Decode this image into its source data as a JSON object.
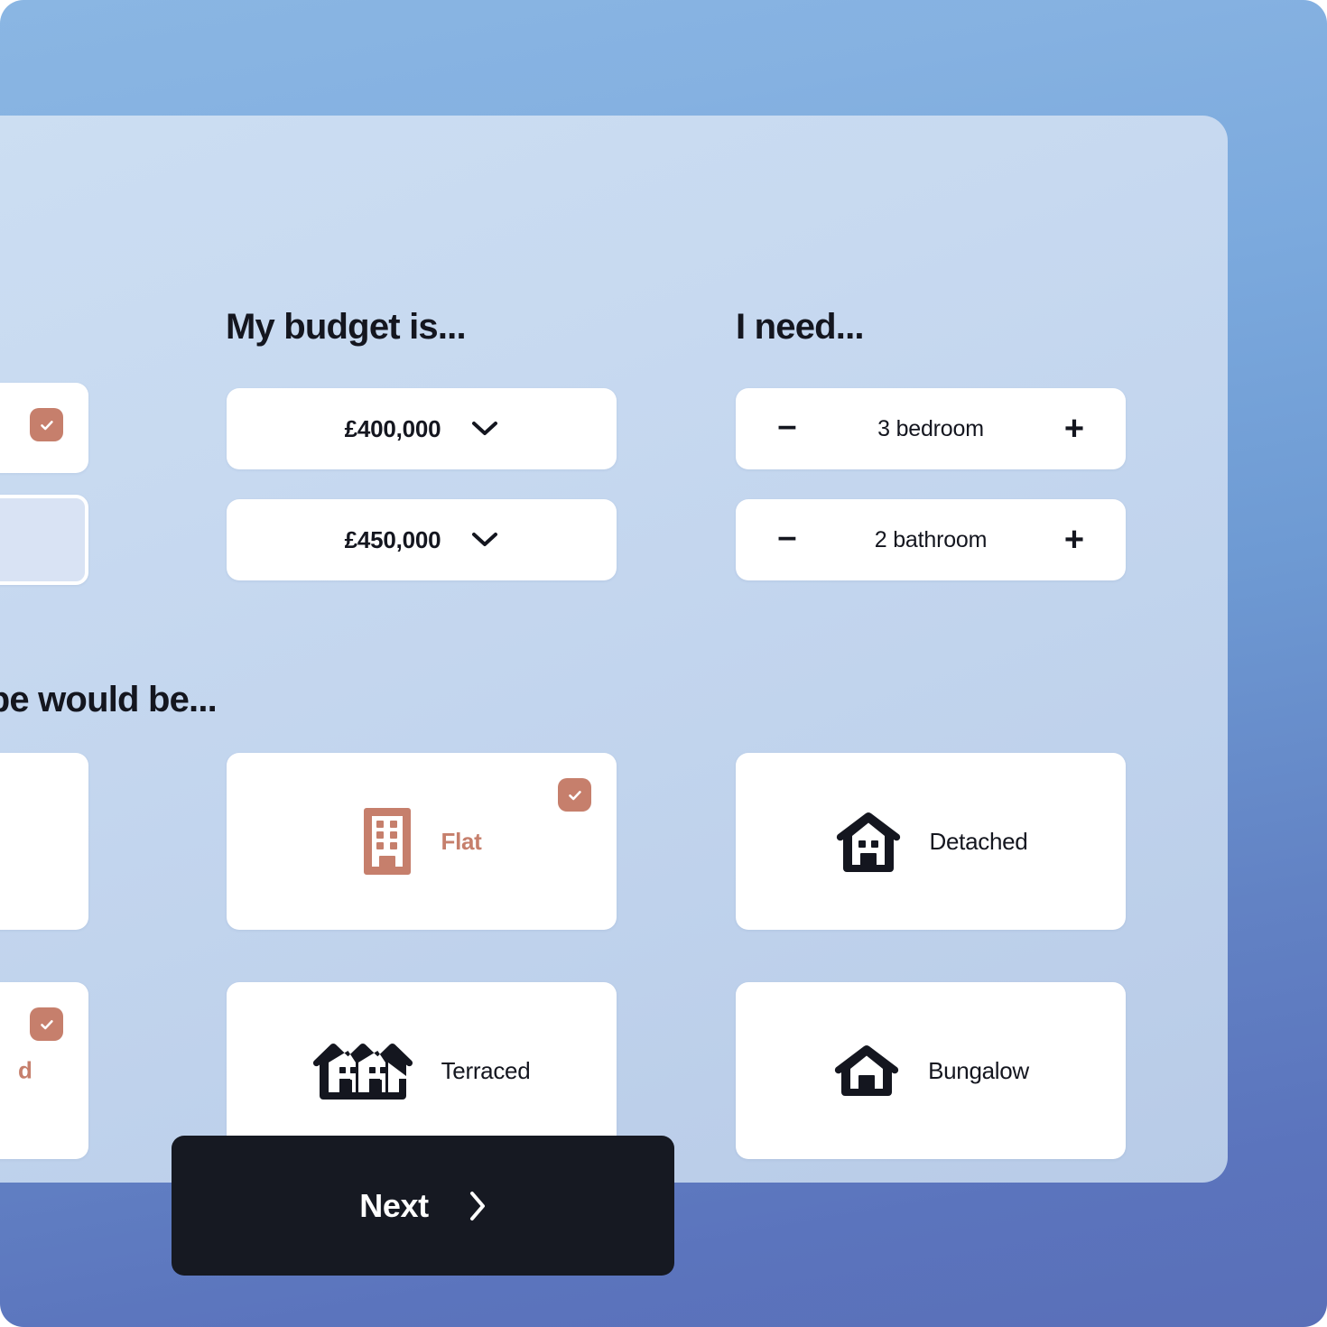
{
  "theme": {
    "accent": "#c67f6c",
    "ink": "#14161f",
    "panel_bg": "#cddff3",
    "card_bg": "#ffffff",
    "button_bg": "#161922",
    "backdrop_top": "#8ab6e3",
    "backdrop_bottom": "#5a6fb8"
  },
  "budget": {
    "heading": "My budget is...",
    "min": {
      "value": "£400,000",
      "icon": "chevron-down-icon"
    },
    "max": {
      "value": "£450,000",
      "icon": "chevron-down-icon"
    }
  },
  "needs": {
    "heading": "I need...",
    "bedroom": {
      "value": "3 bedroom",
      "decrement_label": "–",
      "increment_label": "+"
    },
    "bathroom": {
      "value": "2 bathroom",
      "decrement_label": "–",
      "increment_label": "+"
    }
  },
  "property_type": {
    "heading": "operty type would be...",
    "cards": [
      {
        "label": "Flat",
        "icon": "apartment-building-icon",
        "selected": true
      },
      {
        "label": "Detached",
        "icon": "detached-house-icon",
        "selected": false
      },
      {
        "label": "Terraced",
        "icon": "terraced-houses-icon",
        "selected": false
      },
      {
        "label": "Bungalow",
        "icon": "bungalow-house-icon",
        "selected": false
      }
    ],
    "clipped_card_label": "d"
  },
  "footer": {
    "next_label": "Next",
    "next_icon": "chevron-right-icon"
  }
}
